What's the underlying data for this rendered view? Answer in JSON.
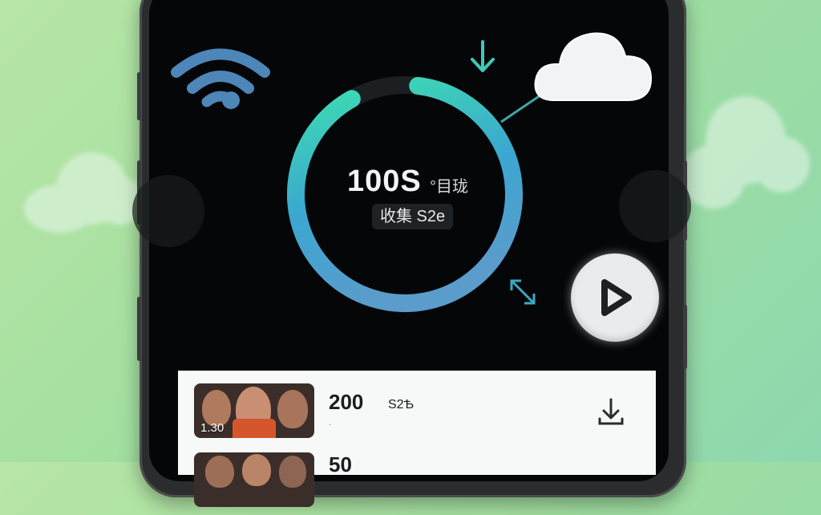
{
  "ring": {
    "value": "100S",
    "unit": "°目珑",
    "badge": "收集 S2e",
    "progress": 0.9,
    "colors": {
      "start": "#3ee0b0",
      "end": "#3a8fd6",
      "track": "#1c1f22"
    }
  },
  "icons": {
    "wifi": "wifi-icon",
    "download_arrow": "download-arrow-icon",
    "cloud": "cloud-icon",
    "expand": "expand-icon",
    "play": "play-icon",
    "download": "download-icon"
  },
  "downloads": {
    "items": [
      {
        "duration": "1.30",
        "count": "200",
        "label": "S2Ѣ",
        "sub": "."
      },
      {
        "duration": "",
        "count": "50",
        "label": "",
        "sub": ""
      }
    ]
  },
  "colors": {
    "accent": "#3ec9b8",
    "screen": "#050607",
    "background": "#a2dfa0"
  }
}
